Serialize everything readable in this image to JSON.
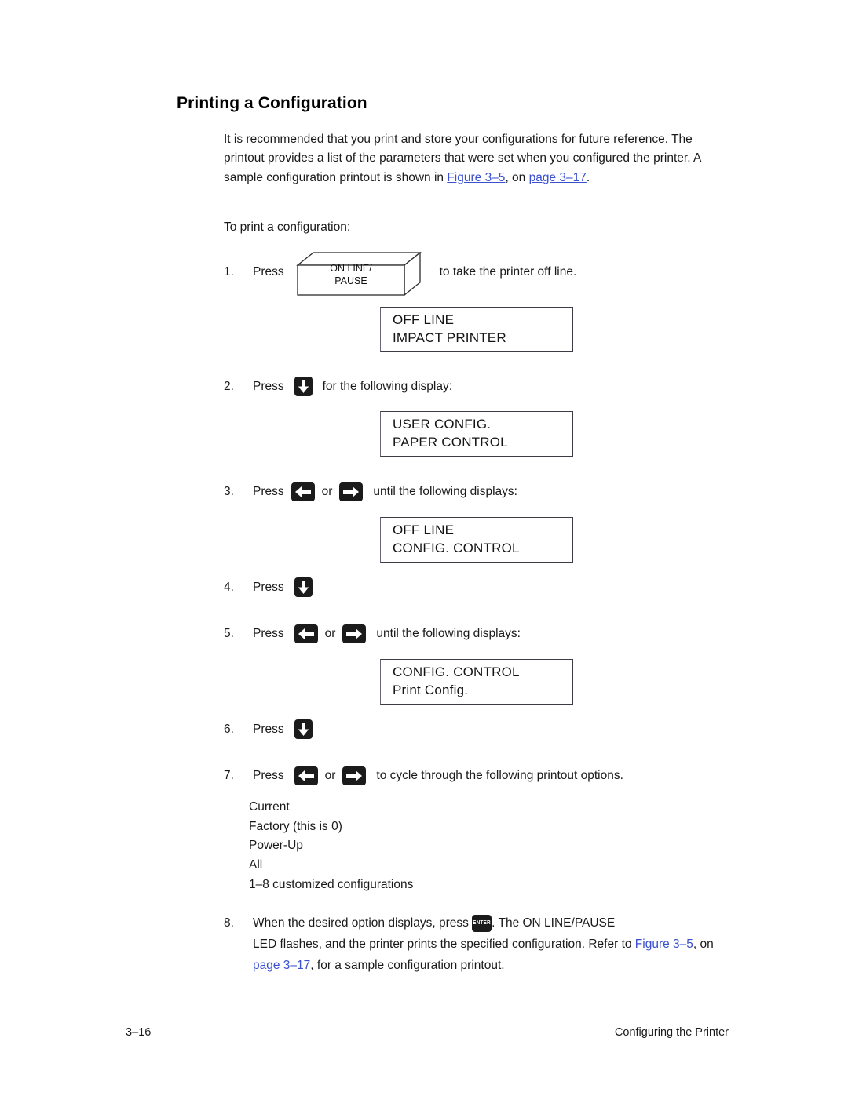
{
  "document": {
    "heading": "Printing a Configuration",
    "intro_paragraph": {
      "text_before_link1": "It is recommended that you print and store your configurations for future reference. The printout provides a list of the parameters that were set when you configured the printer. A sample configuration printout is shown in ",
      "link1": "Figure 3–5",
      "text_between": ", on ",
      "link2": "page 3–17",
      "text_after": "."
    },
    "lead_in": "To print a configuration:",
    "steps": [
      {
        "number": "1.",
        "press_label": "Press",
        "key": "on-line-pause",
        "after_text": "to take the printer off line."
      },
      {
        "number": "2.",
        "press_label": "Press",
        "key": "down-arrow",
        "after_text": "for the following display:"
      },
      {
        "number": "3.",
        "press_label": "Press",
        "key_left": "left-arrow",
        "or_label": "or",
        "key_right": "right-arrow",
        "after_text": "until the following displays:"
      },
      {
        "number": "4.",
        "press_label": "Press",
        "key": "down-arrow",
        "after_text": ""
      },
      {
        "number": "5.",
        "press_label": "Press",
        "key_left": "left-arrow",
        "or_label": "or",
        "key_right": "right-arrow",
        "after_text": "until the following displays:"
      },
      {
        "number": "6.",
        "press_label": "Press",
        "key": "down-arrow",
        "after_text": ""
      },
      {
        "number": "7.",
        "press_label": "Press",
        "key_left": "left-arrow",
        "or_label": "or",
        "key_right": "right-arrow",
        "after_text": "to cycle through the following printout options."
      },
      {
        "number": "8.",
        "text_before_key": "When the desired option displays, press ",
        "key": "enter",
        "text_after_key_line1": ". The ON LINE/PAUSE",
        "text_line2": "LED flashes, and the printer prints the specified configuration. Refer to ",
        "link1": "Figure 3–5",
        "text_between": ", on ",
        "link2": "page 3–17",
        "text_after": ", for a sample configuration printout."
      }
    ],
    "buttons": {
      "on_line_pause_line1": "ON LINE/",
      "on_line_pause_line2": "PAUSE",
      "enter_label": "ENTER"
    },
    "displays": [
      {
        "line1": "OFF LINE",
        "line2": "IMPACT PRINTER"
      },
      {
        "line1": "USER CONFIG.",
        "line2": "PAPER CONTROL"
      },
      {
        "line1": "OFF LINE",
        "line2": "CONFIG. CONTROL"
      },
      {
        "line1": "CONFIG. CONTROL",
        "line2": "Print Config."
      }
    ],
    "printout_options": [
      "Current",
      "Factory (this is 0)",
      "Power-Up",
      "All",
      "1–8 customized configurations"
    ],
    "footer": {
      "page_number": "3–16",
      "chapter_title": "Configuring the Printer"
    },
    "colors": {
      "link": "#3a50d0",
      "text": "#1a1a1a",
      "key_fill": "#1b1b1b",
      "lcd_border": "#3c3c46"
    }
  }
}
